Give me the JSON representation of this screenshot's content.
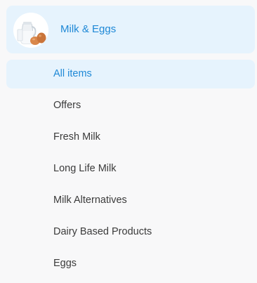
{
  "category": {
    "title": "Milk & Eggs",
    "icon": "milk-and-eggs-image"
  },
  "subnav": {
    "items": [
      {
        "label": "All items",
        "active": true
      },
      {
        "label": "Offers",
        "active": false
      },
      {
        "label": "Fresh Milk",
        "active": false
      },
      {
        "label": "Long Life Milk",
        "active": false
      },
      {
        "label": "Milk Alternatives",
        "active": false
      },
      {
        "label": "Dairy Based Products",
        "active": false
      },
      {
        "label": "Eggs",
        "active": false
      }
    ]
  },
  "colors": {
    "accent": "#1e88d6",
    "highlight": "#e6f3fd",
    "panel_background": "#f8f8f9",
    "text": "#3b3b3b"
  }
}
